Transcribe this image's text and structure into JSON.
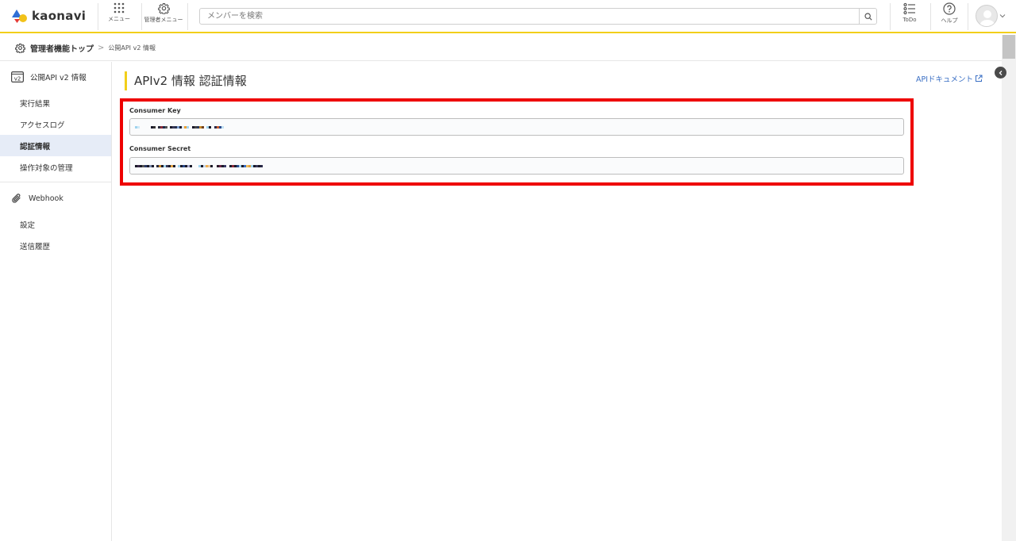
{
  "header": {
    "logo_text": "kaonavi",
    "menu_label": "メニュー",
    "admin_menu_label": "管理者メニュー",
    "search_placeholder": "メンバーを検索",
    "todo_label": "ToDo",
    "help_label": "ヘルプ"
  },
  "breadcrumb": {
    "top": "管理者機能トップ",
    "separator": ">",
    "current": "公開API v2 情報"
  },
  "sidebar": {
    "section_api": {
      "icon_text": "v2",
      "label": "公開API v2 情報",
      "items": [
        {
          "label": "実行結果"
        },
        {
          "label": "アクセスログ"
        },
        {
          "label": "認証情報",
          "active": true
        },
        {
          "label": "操作対象の管理"
        }
      ]
    },
    "section_webhook": {
      "label": "Webhook",
      "items": [
        {
          "label": "設定"
        },
        {
          "label": "送信履歴"
        }
      ]
    }
  },
  "main": {
    "title": "APIv2 情報 認証情報",
    "doc_link": "APIドキュメント",
    "fields": {
      "consumer_key_label": "Consumer Key",
      "consumer_secret_label": "Consumer Secret"
    }
  },
  "colors": {
    "accent_yellow": "#f2cf1a",
    "highlight_red": "#ee0000",
    "link_blue": "#3a6fc4",
    "active_bg": "#e6ecf7"
  }
}
